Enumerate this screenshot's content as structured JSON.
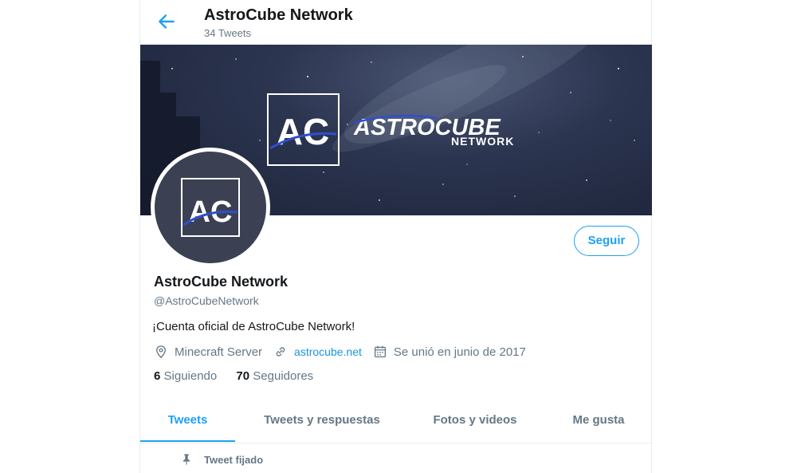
{
  "header": {
    "title": "AstroCube Network",
    "subtitle": "34 Tweets"
  },
  "banner": {
    "logo_mark": "AC",
    "brand_name": "ASTROCUBE",
    "brand_sub": "NETWORK"
  },
  "avatar": {
    "logo_mark": "AC"
  },
  "profile": {
    "follow_label": "Seguir",
    "name": "AstroCube Network",
    "handle": "@AstroCubeNetwork",
    "bio": "¡Cuenta oficial de AstroCube Network!",
    "location": "Minecraft Server",
    "website": "astrocube.net",
    "joined": "Se unió en junio de 2017",
    "following_count": "6",
    "following_label": "Siguiendo",
    "followers_count": "70",
    "followers_label": "Seguidores"
  },
  "tabs": [
    {
      "label": "Tweets",
      "active": true
    },
    {
      "label": "Tweets y respuestas",
      "active": false
    },
    {
      "label": "Fotos y videos",
      "active": false
    },
    {
      "label": "Me gusta",
      "active": false
    }
  ],
  "pinned": {
    "label": "Tweet fijado"
  },
  "colors": {
    "accent": "#1da1f2",
    "link": "#1b95e0",
    "muted": "#657786",
    "text": "#14171a",
    "banner_bg": "#2c3550",
    "avatar_bg": "#3b4152",
    "logo_blue": "#2f4fcf"
  },
  "icons": {
    "back": "arrow-left-icon",
    "location": "location-pin-icon",
    "website": "link-icon",
    "joined": "calendar-icon",
    "pinned": "pin-icon"
  }
}
